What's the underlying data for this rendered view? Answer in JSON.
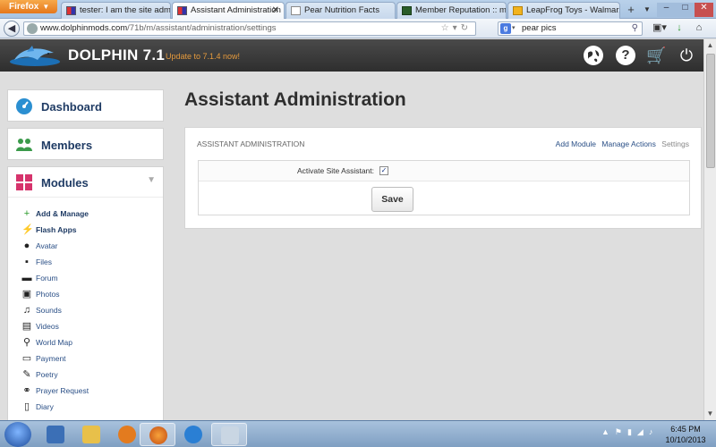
{
  "browser": {
    "menu_label": "Firefox",
    "tabs": [
      {
        "title": "tester: I am the site adm..."
      },
      {
        "title": "Assistant Administration"
      },
      {
        "title": "Pear Nutrition Facts"
      },
      {
        "title": "Member Reputation :: m..."
      },
      {
        "title": "LeapFrog Toys - Walmar..."
      }
    ],
    "new_tab": "+",
    "url_host": "www.dolphinmods.com",
    "url_path": "/71b/m/assistant/administration/settings",
    "search_value": "pear pics",
    "search_engine": "g"
  },
  "header": {
    "brand": "DOLPHIN 7.1",
    "update_notice": "Update to 7.1.4 now!"
  },
  "sidebar": {
    "dashboard": "Dashboard",
    "members": "Members",
    "modules": "Modules",
    "module_items": [
      {
        "label": "Add & Manage",
        "icon": "plus-icon",
        "glyph": "+",
        "bold": true,
        "color": "#2a9a2a"
      },
      {
        "label": "Flash Apps",
        "icon": "flash-icon",
        "glyph": "⚡",
        "bold": true,
        "color": "#d6336c"
      },
      {
        "label": "Avatar",
        "icon": "user-icon",
        "glyph": "●",
        "bold": false,
        "color": "#222222"
      },
      {
        "label": "Files",
        "icon": "file-icon",
        "glyph": "▪",
        "bold": false,
        "color": "#222222"
      },
      {
        "label": "Forum",
        "icon": "forum-icon",
        "glyph": "▬",
        "bold": false,
        "color": "#222222"
      },
      {
        "label": "Photos",
        "icon": "photo-icon",
        "glyph": "▣",
        "bold": false,
        "color": "#222222"
      },
      {
        "label": "Sounds",
        "icon": "music-icon",
        "glyph": "♫",
        "bold": false,
        "color": "#222222"
      },
      {
        "label": "Videos",
        "icon": "film-icon",
        "glyph": "▤",
        "bold": false,
        "color": "#222222"
      },
      {
        "label": "World Map",
        "icon": "map-pin-icon",
        "glyph": "⚲",
        "bold": false,
        "color": "#222222"
      },
      {
        "label": "Payment",
        "icon": "card-icon",
        "glyph": "▭",
        "bold": false,
        "color": "#222222"
      },
      {
        "label": "Poetry",
        "icon": "pen-icon",
        "glyph": "✎",
        "bold": false,
        "color": "#222222"
      },
      {
        "label": "Prayer Request",
        "icon": "paperclip-icon",
        "glyph": "⚭",
        "bold": false,
        "color": "#222222"
      },
      {
        "label": "Diary",
        "icon": "book-icon",
        "glyph": "▯",
        "bold": false,
        "color": "#222222"
      }
    ]
  },
  "main": {
    "page_title": "Assistant Administration",
    "panel_title": "ASSISTANT ADMINISTRATION",
    "actions": {
      "add_module": "Add Module",
      "manage_actions": "Manage Actions",
      "settings": "Settings"
    },
    "form": {
      "activate_label": "Activate Site Assistant:",
      "activate_checked": true,
      "check_mark": "✓",
      "save_label": "Save"
    }
  },
  "taskbar": {
    "time": "6:45 PM",
    "date": "10/10/2013"
  },
  "colors": {
    "accent_link": "#2a4f86",
    "update_orange": "#e59a3d",
    "dashboard_icon": "#2b8fd1",
    "members_icon": "#3a9a4a",
    "modules_icon": "#d6336c"
  }
}
